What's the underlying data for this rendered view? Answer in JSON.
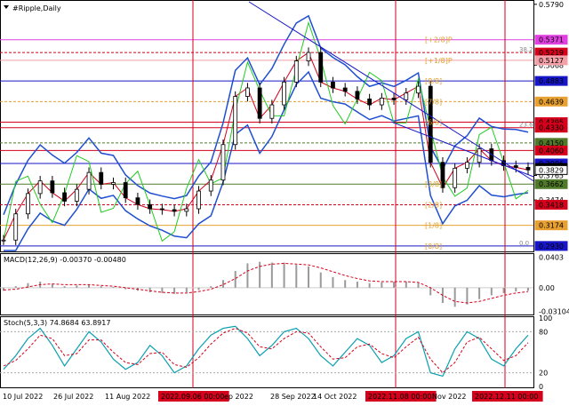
{
  "chart_data": [
    {
      "type": "candlestick",
      "title": "#Ripple,Daily",
      "ylim": [
        0.2876,
        0.582
      ],
      "y_ticks": [
        0.579,
        0.5068,
        0.3765,
        0.3474
      ],
      "price_labels": [
        {
          "value": 0.5371,
          "color": "#e040e0"
        },
        {
          "value": 0.5219,
          "color": "#d4001c"
        },
        {
          "value": 0.5127,
          "color": "#f4a0a8"
        },
        {
          "value": 0.4883,
          "color": "#1616c8"
        },
        {
          "value": 0.4639,
          "color": "#e8a030"
        },
        {
          "value": 0.4395,
          "color": "#d4001c"
        },
        {
          "value": 0.433,
          "color": "#d4001c"
        },
        {
          "value": 0.415,
          "color": "#507a2a"
        },
        {
          "value": 0.406,
          "color": "#d4001c"
        },
        {
          "value": 0.3906,
          "color": "#1616c8"
        },
        {
          "value": 0.3853,
          "color": "#000000"
        },
        {
          "value": 0.3829,
          "color": "#ffffff"
        },
        {
          "value": 0.3662,
          "color": "#507a2a"
        },
        {
          "value": 0.3418,
          "color": "#d4001c"
        },
        {
          "value": 0.3174,
          "color": "#e8a030"
        },
        {
          "value": 0.293,
          "color": "#1616c8"
        }
      ],
      "murrey_labels": [
        {
          "text": "[+2/8]P",
          "value": 0.5371
        },
        {
          "text": "[+1/8]P",
          "value": 0.5127
        },
        {
          "text": "[8/8]",
          "value": 0.4883
        },
        {
          "text": "[7/8]",
          "value": 0.4639
        },
        {
          "text": "[6/8]",
          "value": 0.4395
        },
        {
          "text": "[3/8]",
          "value": 0.3662
        },
        {
          "text": "[2/8]",
          "value": 0.3418
        },
        {
          "text": "[1/8]",
          "value": 0.3174
        },
        {
          "text": "[0/8]",
          "value": 0.293
        }
      ],
      "fib_labels": [
        {
          "text": "38.2",
          "value": 0.5219
        },
        {
          "text": "23.6",
          "value": 0.433
        },
        {
          "text": "0.0",
          "value": 0.293
        }
      ],
      "x_labels": [
        "10 Jul 2022",
        "26 Jul 2022",
        "11 Aug 2022",
        "2022.09.06 00:00",
        "ep 2022",
        "28 Sep 2022",
        "14 Oct 2022",
        "2022.11.08 00:00",
        "Nov 2022",
        "2022.12.11 00:00"
      ],
      "x_label_style": [
        "plain",
        "plain",
        "plain",
        "highlight",
        "plain",
        "plain",
        "plain",
        "highlight",
        "plain",
        "highlight"
      ],
      "series": [
        {
          "values": [
            0.3,
            0.331,
            0.355,
            0.37,
            0.356,
            0.346,
            0.36,
            0.38,
            0.366,
            0.368,
            0.35,
            0.342,
            0.337,
            0.336,
            0.334,
            0.337,
            0.358,
            0.371,
            0.413,
            0.47,
            0.48,
            0.444,
            0.46,
            0.487,
            0.512,
            0.522,
            0.487,
            0.48,
            0.476,
            0.467,
            0.46,
            0.468,
            0.466,
            0.474,
            0.482,
            0.392,
            0.362,
            0.385,
            0.392,
            0.408,
            0.394,
            0.388,
            0.386,
            0.383
          ]
        }
      ]
    },
    {
      "type": "bar",
      "title": "MACD(12,26,9) -0.00370 -0.00480",
      "y_ticks": [
        "0.0403",
        "0.00",
        "-0.03104"
      ],
      "ylim": [
        -0.034,
        0.043
      ],
      "series": [
        {
          "values": [
            -0.004,
            0.002,
            0.006,
            0.008,
            0.005,
            0.002,
            0.003,
            0.004,
            0.002,
            0.001,
            -0.002,
            -0.004,
            -0.006,
            -0.007,
            -0.008,
            -0.006,
            -0.003,
            0.002,
            0.01,
            0.022,
            0.032,
            0.034,
            0.033,
            0.033,
            0.03,
            0.028,
            0.02,
            0.014,
            0.01,
            0.008,
            0.006,
            0.007,
            0.008,
            0.008,
            0.006,
            -0.01,
            -0.02,
            -0.025,
            -0.022,
            -0.015,
            -0.01,
            -0.007,
            -0.005,
            -0.004
          ]
        },
        {
          "values": [
            -0.003,
            -0.002,
            0.001,
            0.004,
            0.005,
            0.004,
            0.004,
            0.004,
            0.003,
            0.002,
            0.0,
            -0.002,
            -0.004,
            -0.006,
            -0.007,
            -0.007,
            -0.005,
            -0.002,
            0.004,
            0.012,
            0.022,
            0.028,
            0.031,
            0.032,
            0.031,
            0.03,
            0.026,
            0.021,
            0.016,
            0.012,
            0.009,
            0.008,
            0.008,
            0.008,
            0.007,
            0.0,
            -0.01,
            -0.018,
            -0.02,
            -0.018,
            -0.014,
            -0.01,
            -0.007,
            -0.005
          ]
        }
      ]
    },
    {
      "type": "line",
      "title": "Stoch(5,3,3) 74.8684 63.8917",
      "y_ticks": [
        "100",
        "80",
        "20",
        "0"
      ],
      "ylim": [
        0,
        100
      ],
      "series": [
        {
          "values": [
            25,
            45,
            70,
            85,
            60,
            30,
            55,
            80,
            65,
            40,
            25,
            35,
            60,
            45,
            20,
            30,
            55,
            75,
            85,
            88,
            70,
            45,
            60,
            80,
            85,
            70,
            45,
            30,
            50,
            70,
            60,
            35,
            45,
            70,
            80,
            20,
            15,
            55,
            80,
            70,
            40,
            30,
            55,
            75
          ]
        },
        {
          "values": [
            30,
            38,
            55,
            75,
            70,
            45,
            48,
            68,
            68,
            50,
            35,
            32,
            48,
            50,
            32,
            28,
            42,
            62,
            78,
            85,
            78,
            58,
            55,
            70,
            80,
            78,
            58,
            40,
            42,
            58,
            62,
            48,
            42,
            58,
            72,
            40,
            20,
            35,
            65,
            72,
            55,
            38,
            45,
            64
          ]
        }
      ]
    }
  ]
}
